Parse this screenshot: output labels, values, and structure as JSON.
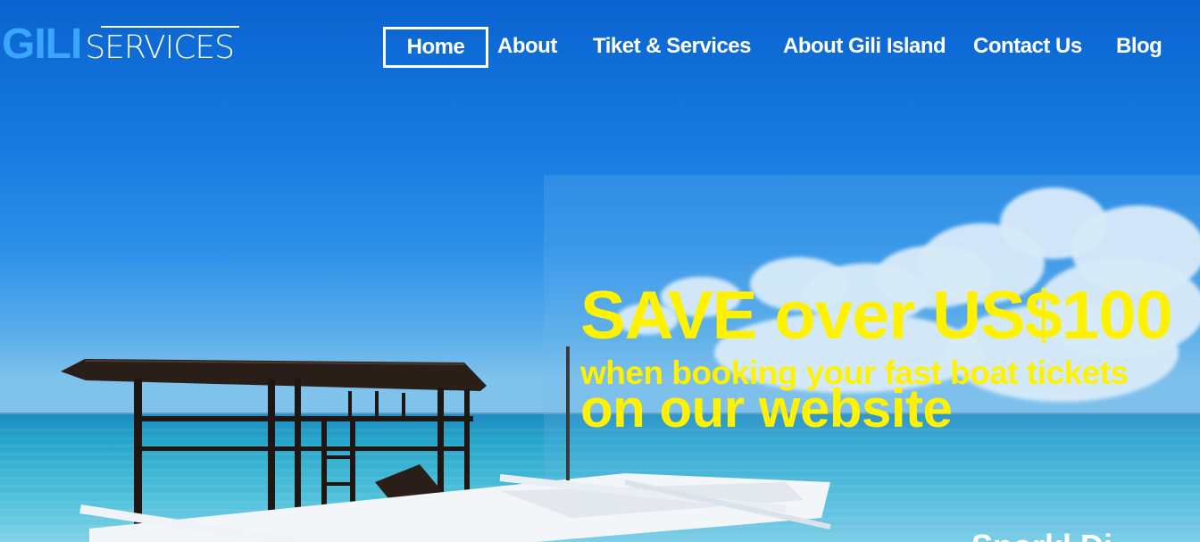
{
  "brand": {
    "logo_part1": "GILI",
    "logo_part2": "SERVICES"
  },
  "nav": {
    "items": [
      {
        "label": "Home",
        "active": true
      },
      {
        "label": "About",
        "active": false
      },
      {
        "label": "Tiket & Services",
        "active": false
      },
      {
        "label": "About Gili Island",
        "active": false
      },
      {
        "label": "Contact Us",
        "active": false
      },
      {
        "label": "Blog",
        "active": false
      }
    ]
  },
  "promo": {
    "title": "SAVE over US$100",
    "subtitle_line1": "when booking your fast boat tickets",
    "subtitle_line2": "on our website"
  },
  "partial_text": "Snorkl Di",
  "colors": {
    "accent_logo": "#3aa6ff",
    "promo_text": "#fff200",
    "nav_text": "#ffffff"
  }
}
